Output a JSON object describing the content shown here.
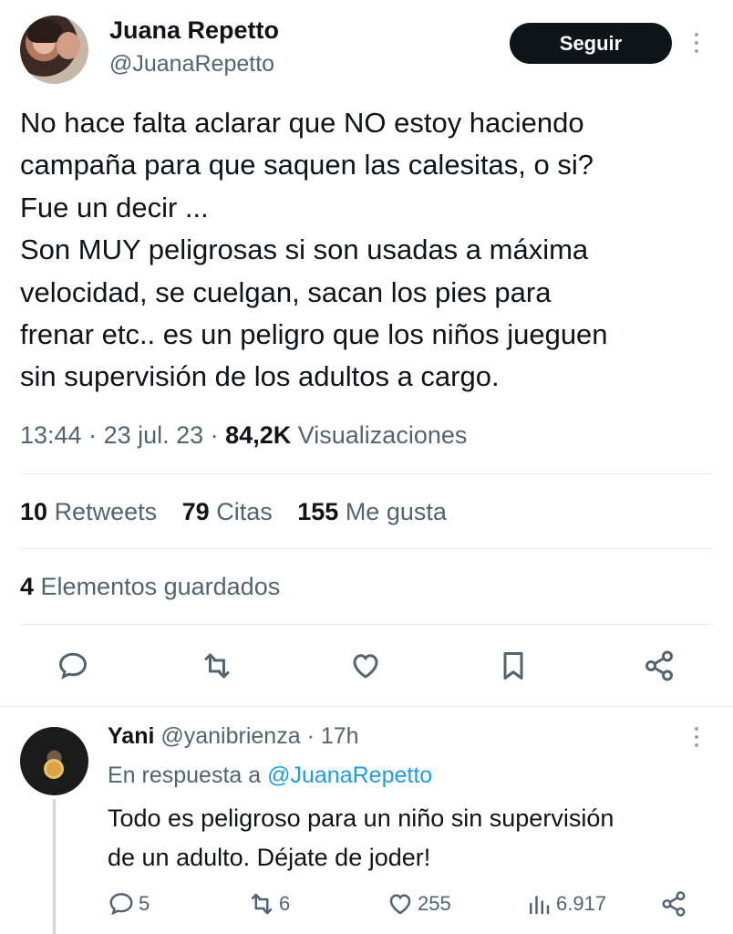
{
  "tweet": {
    "author_name": "Juana Repetto",
    "author_handle": "@JuanaRepetto",
    "follow_label": "Seguir",
    "text": "No hace falta aclarar que NO estoy haciendo\ncampaña para que saquen las calesitas, o si?\nFue un decir ...\nSon MUY peligrosas si son usadas a máxima\nvelocidad, se cuelgan, sacan los pies para\nfrenar etc.. es un peligro que los niños jueguen\nsin supervisión de los adultos a cargo.",
    "time": "13:44",
    "date": "23 jul. 23",
    "views_count": "84,2K",
    "views_label": "Visualizaciones",
    "retweets_count": "10",
    "retweets_label": "Retweets",
    "quotes_count": "79",
    "quotes_label": "Citas",
    "likes_count": "155",
    "likes_label": "Me gusta",
    "bookmarks_count": "4",
    "bookmarks_label": "Elementos guardados",
    "actions": [
      "reply-icon",
      "retweet-icon",
      "like-icon",
      "bookmark-icon",
      "share-icon"
    ]
  },
  "reply": {
    "author_name": "Yani",
    "author_handle": "@yanibrienza",
    "time_ago": "17h",
    "in_reply_prefix": "En respuesta a",
    "in_reply_mention": "@JuanaRepetto",
    "text": "Todo es peligroso para un niño sin supervisión\nde un adulto. Déjate de joder!",
    "replies": "5",
    "retweets": "6",
    "likes": "255",
    "views": "6.917"
  },
  "colors": {
    "text": "#0f1419",
    "secondary": "#536471",
    "link": "#1d9bf0",
    "button": "#0f1419",
    "divider": "#e6ecf0"
  }
}
